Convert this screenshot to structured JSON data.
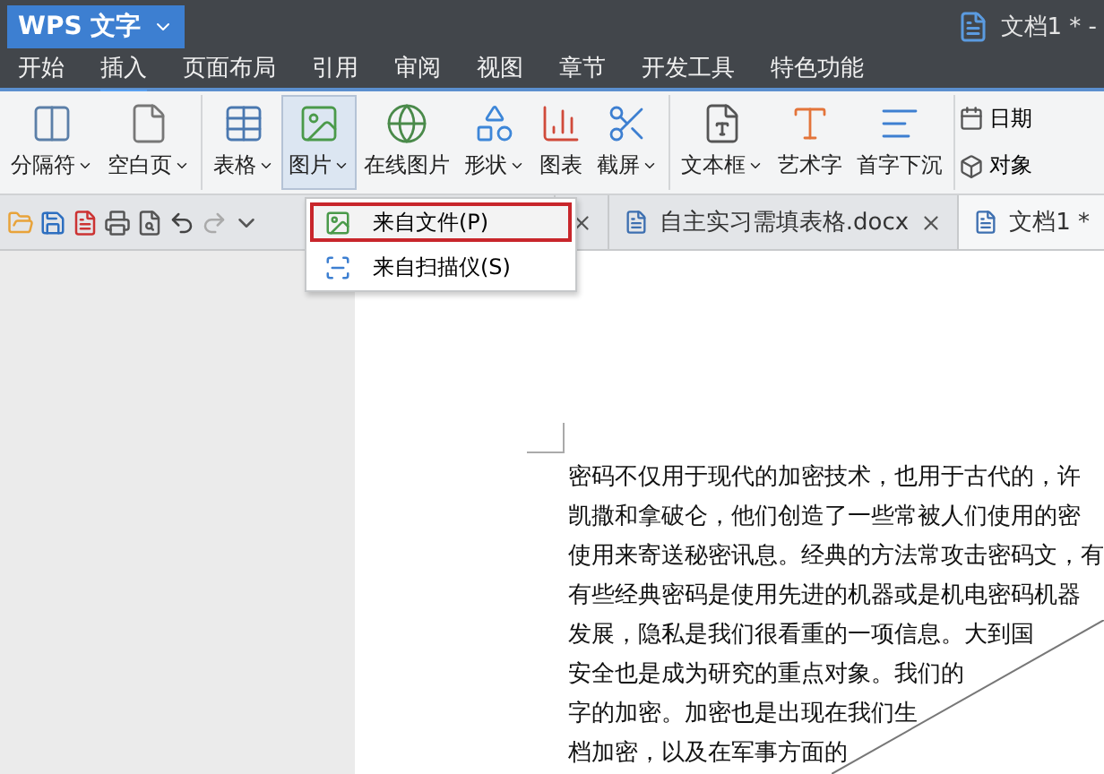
{
  "app": {
    "name": "WPS 文字",
    "document": "文档1 * -"
  },
  "menu_tabs": [
    {
      "label": "开始",
      "selected": false
    },
    {
      "label": "插入",
      "selected": true
    },
    {
      "label": "页面布局",
      "selected": false
    },
    {
      "label": "引用",
      "selected": false
    },
    {
      "label": "审阅",
      "selected": false
    },
    {
      "label": "视图",
      "selected": false
    },
    {
      "label": "章节",
      "selected": false
    },
    {
      "label": "开发工具",
      "selected": false
    },
    {
      "label": "特色功能",
      "selected": false
    }
  ],
  "ribbon_groups": [
    [
      {
        "label": "分隔符",
        "caret": true,
        "selected": false
      },
      {
        "label": "空白页",
        "caret": true,
        "selected": false
      }
    ],
    [
      {
        "label": "表格",
        "caret": true,
        "selected": false
      },
      {
        "label": "图片",
        "caret": true,
        "selected": true
      },
      {
        "label": "在线图片",
        "caret": false,
        "selected": false
      },
      {
        "label": "形状",
        "caret": true,
        "selected": false
      },
      {
        "label": "图表",
        "caret": false,
        "selected": false
      },
      {
        "label": "截屏",
        "caret": true,
        "selected": false
      }
    ],
    [
      {
        "label": "文本框",
        "caret": true,
        "selected": false
      },
      {
        "label": "艺术字",
        "caret": false,
        "selected": false
      },
      {
        "label": "首字下沉",
        "caret": false,
        "selected": false
      }
    ]
  ],
  "ribbon_small": [
    {
      "label": "日期"
    },
    {
      "label": "对象"
    }
  ],
  "dropdown": [
    {
      "label": "来自文件(P)",
      "selected": true
    },
    {
      "label": "来自扫描仪(S)",
      "selected": false
    }
  ],
  "doc_tabs": [
    {
      "selected": false,
      "closable": true
    },
    {
      "label": "自主实习需填表格.docx",
      "selected": false,
      "closable": true
    },
    {
      "label": "文档1 *",
      "selected": true,
      "closable": false
    }
  ],
  "document_lines": [
    "密码不仅用于现代的加密技术，也用于古代的，许",
    "凯撒和拿破仑，他们创造了一些常被人们使用的密",
    "使用来寄送秘密讯息。经典的方法常攻击密码文，有",
    "有些经典密码是使用先进的机器或是机电密码机器",
    "发展，隐私是我们很看重的一项信息。大到国",
    "安全也是成为研究的重点对象。我们的",
    "字的加密。加密也是出现在我们生",
    "档加密，以及在军事方面的"
  ]
}
